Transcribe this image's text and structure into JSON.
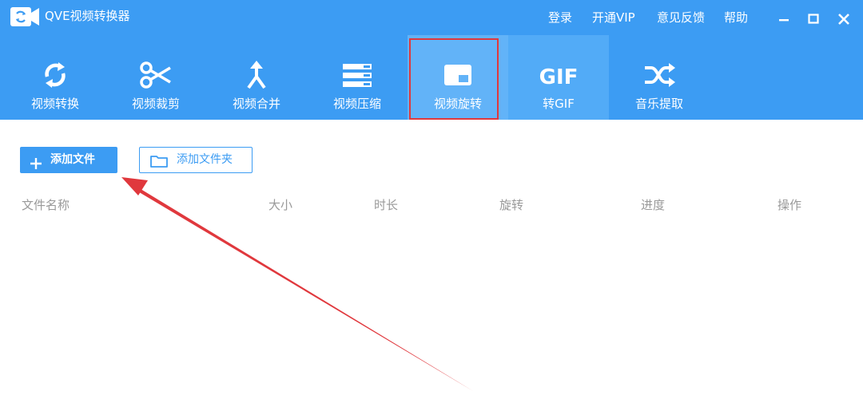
{
  "app": {
    "title": "QVE视频转换器",
    "menu": [
      "登录",
      "开通VIP",
      "意见反馈",
      "帮助"
    ]
  },
  "tabs": [
    {
      "label": "视频转换",
      "icon": "refresh-icon"
    },
    {
      "label": "视频裁剪",
      "icon": "scissors-icon"
    },
    {
      "label": "视频合并",
      "icon": "merge-arrow-icon"
    },
    {
      "label": "视频压缩",
      "icon": "compress-icon"
    },
    {
      "label": "视频旋转",
      "icon": "rotate-icon",
      "active": true
    },
    {
      "label": "转GIF",
      "icon": "gif-icon",
      "icon_text": "GIF"
    },
    {
      "label": "音乐提取",
      "icon": "shuffle-icon"
    }
  ],
  "toolbar": {
    "add_file": "添加文件",
    "add_folder": "添加文件夹"
  },
  "table": {
    "columns": [
      "文件名称",
      "大小",
      "时长",
      "旋转",
      "进度",
      "操作"
    ]
  },
  "colors": {
    "primary": "#3c9cf3",
    "active_tab": "#62b3f8",
    "annotation": "#e0383d"
  }
}
